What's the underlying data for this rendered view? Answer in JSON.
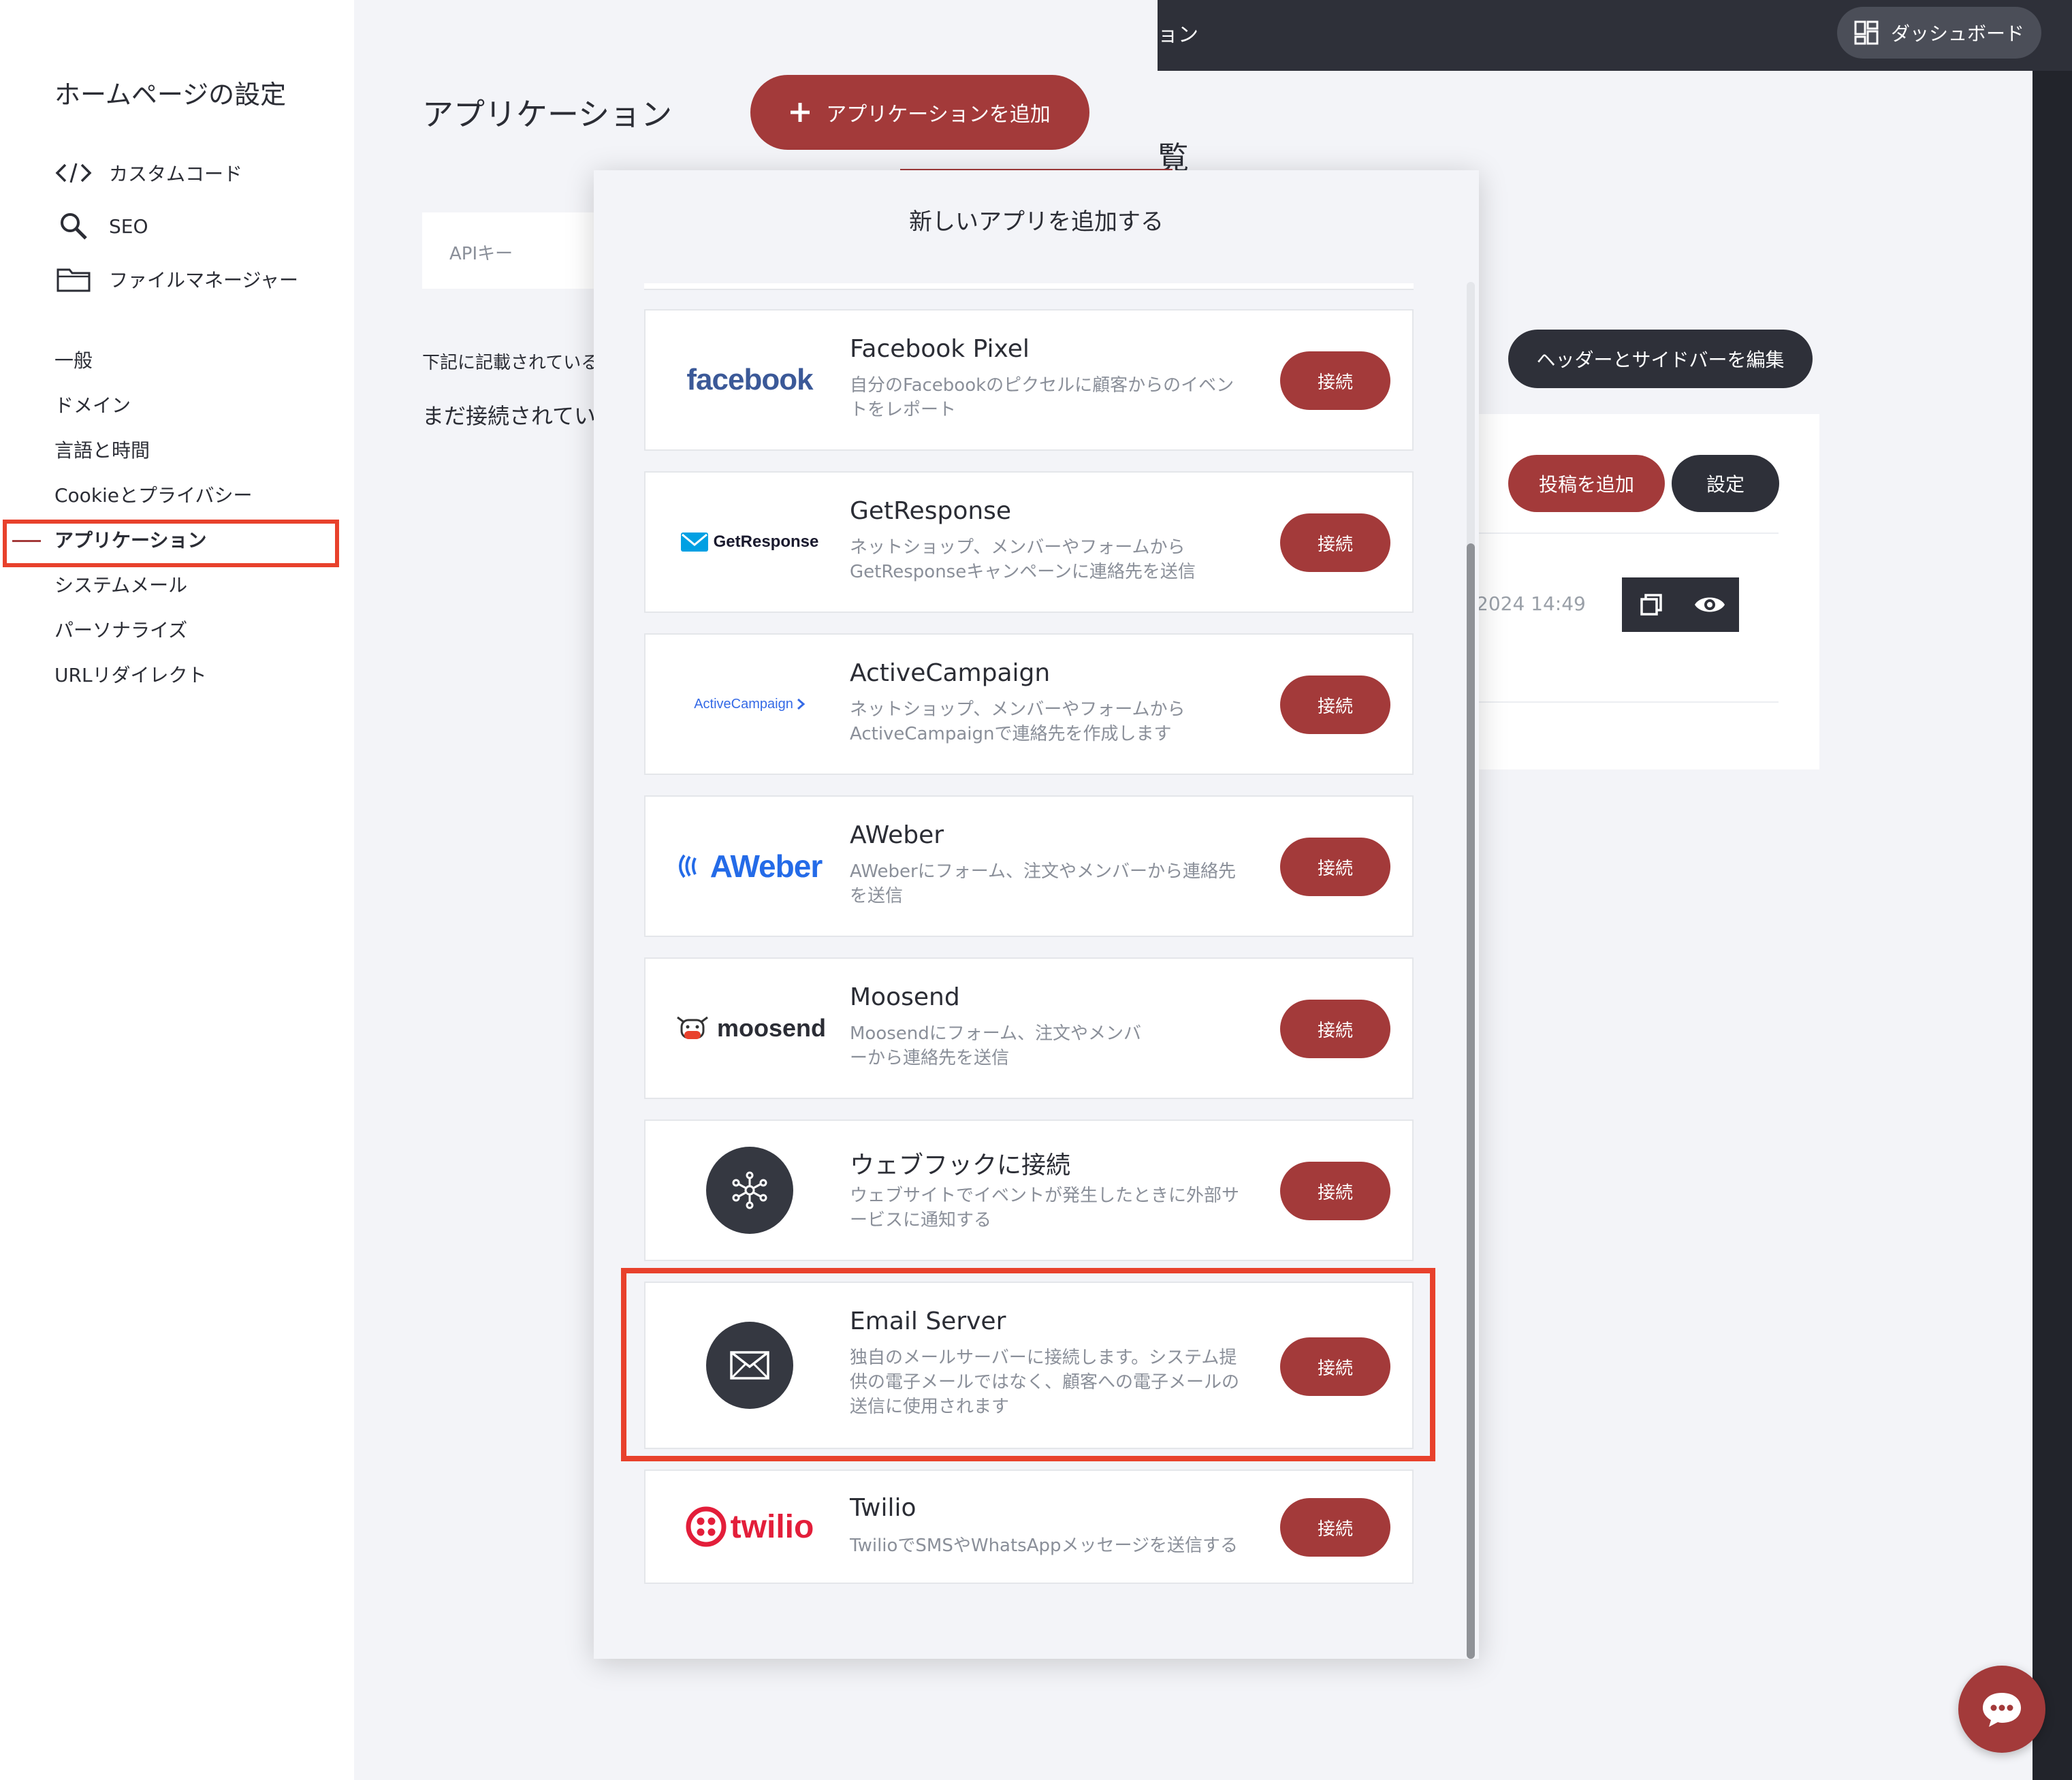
{
  "background": {
    "topbar_partial_text": "ョン",
    "dashboard_button": "ダッシュボード",
    "edit_header_button": "ヘッダーとサイドバーを編集",
    "add_post_button": "投稿を追加",
    "settings_button": "設定",
    "date_partial": "2024 14:49",
    "heading_partial": "覧"
  },
  "sidebar": {
    "title": "ホームページの設定",
    "tools": [
      {
        "label": "カスタムコード",
        "icon": "code-icon"
      },
      {
        "label": "SEO",
        "icon": "search-icon"
      },
      {
        "label": "ファイルマネージャー",
        "icon": "folder-icon"
      }
    ],
    "menu": [
      {
        "label": "一般"
      },
      {
        "label": "ドメイン"
      },
      {
        "label": "言語と時間"
      },
      {
        "label": "Cookieとプライバシー"
      },
      {
        "label": "アプリケーション",
        "active": true
      },
      {
        "label": "システムメール"
      },
      {
        "label": "パーソナライズ"
      },
      {
        "label": "URLリダイレクト"
      }
    ]
  },
  "settings_panel": {
    "title": "アプリケーション",
    "add_app_button": "アプリケーションを追加",
    "api_key_label": "APIキー",
    "description_partial": "下記に記載されている",
    "empty_partial": "まだ接続されてい"
  },
  "modal": {
    "title": "新しいアプリを追加する",
    "connect_label": "接続",
    "apps": [
      {
        "name": "Facebook Pixel",
        "description": "自分のFacebookのピクセルに顧客からのイベントをレポート",
        "logo_text": "facebook"
      },
      {
        "name": "GetResponse",
        "description": "ネットショップ、メンバーやフォームからGetResponseキャンペーンに連絡先を送信",
        "logo_text": "GetResponse"
      },
      {
        "name": "ActiveCampaign",
        "description": "ネットショップ、メンバーやフォームからActiveCampaignで連絡先を作成します",
        "logo_text": "ActiveCampaign"
      },
      {
        "name": "AWeber",
        "description": "AWeberにフォーム、注文やメンバーから連絡先を送信",
        "logo_text": "AWeber"
      },
      {
        "name": "Moosend",
        "description": "Moosendにフォーム、注文やメンバーから連絡先を送信",
        "logo_text": "moosend"
      },
      {
        "name": "ウェブフックに接続",
        "description": "ウェブサイトでイベントが発生したときに外部サービスに通知する",
        "logo_text": ""
      },
      {
        "name": "Email Server",
        "description": "独自のメールサーバーに接続します。システム提供の電子メールではなく、顧客への電子メールの送信に使用されます",
        "logo_text": ""
      },
      {
        "name": "Twilio",
        "description": "TwilioでSMSやWhatsAppメッセージを送信する",
        "logo_text": "twilio"
      }
    ]
  },
  "colors": {
    "accent": "#a33a3a",
    "highlight": "#e8412c",
    "dark": "#2e3039"
  }
}
